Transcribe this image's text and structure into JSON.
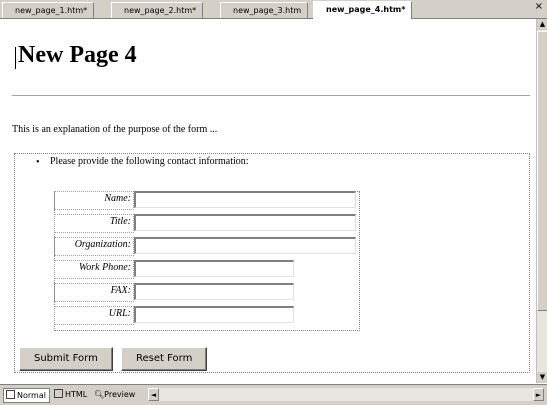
{
  "tabs": [
    {
      "label": "new_page_1.htm*"
    },
    {
      "label": "new_page_2.htm*"
    },
    {
      "label": "new_page_3.htm"
    },
    {
      "label": "new_page_4.htm*"
    }
  ],
  "tab_close": "×",
  "page": {
    "title": "New Page 4",
    "explanation": "This is an explanation of the purpose of the form ...",
    "prompt": "Please provide the following contact information:"
  },
  "form": {
    "fields": [
      {
        "label": "Name",
        "value": ""
      },
      {
        "label": "Title",
        "value": ""
      },
      {
        "label": "Organization",
        "value": ""
      },
      {
        "label": "Work Phone",
        "value": ""
      },
      {
        "label": "FAX",
        "value": ""
      },
      {
        "label": "URL",
        "value": ""
      }
    ],
    "submit_label": "Submit Form",
    "reset_label": "Reset Form"
  },
  "view_tabs": [
    {
      "label": "Normal"
    },
    {
      "label": "HTML"
    },
    {
      "label": "Preview"
    }
  ],
  "scroll_arrows": {
    "up": "▲",
    "down": "▼",
    "left": "◄",
    "right": "►"
  }
}
